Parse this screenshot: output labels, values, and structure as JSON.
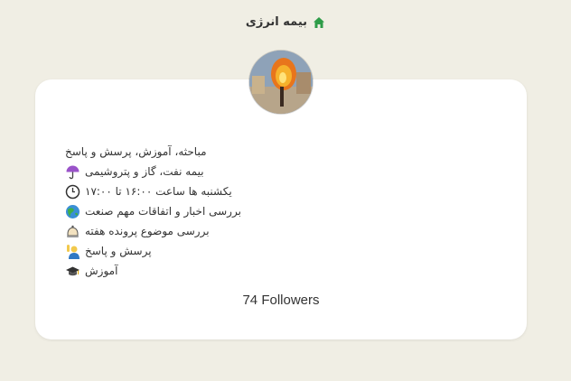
{
  "header": {
    "title": "بیمه انرژی",
    "icon": "home-icon"
  },
  "profile": {
    "avatar": "channel-avatar",
    "description": [
      {
        "text": "مباحثه، آموزش، پرسش و پاسخ",
        "icon": ""
      },
      {
        "text": "بیمه نفت، گاز و پتروشیمی",
        "icon": "umbrella-icon"
      },
      {
        "text": "یکشنبه ها ساعت ۱۶:۰۰ تا ۱۷:۰۰",
        "icon": "clock-icon"
      },
      {
        "text": "بررسی اخبار و اتفاقات مهم صنعت",
        "icon": "globe-icon"
      },
      {
        "text": "بررسی موضوع پرونده هفته",
        "icon": "bell-icon"
      },
      {
        "text": "پرسش و پاسخ",
        "icon": "person-raising-hand-icon"
      },
      {
        "text": "آموزش",
        "icon": "graduation-cap-icon"
      }
    ],
    "followers": "74 Followers"
  },
  "colors": {
    "background": "#f0eee4",
    "card": "#ffffff",
    "accent": "#2e9c48"
  }
}
